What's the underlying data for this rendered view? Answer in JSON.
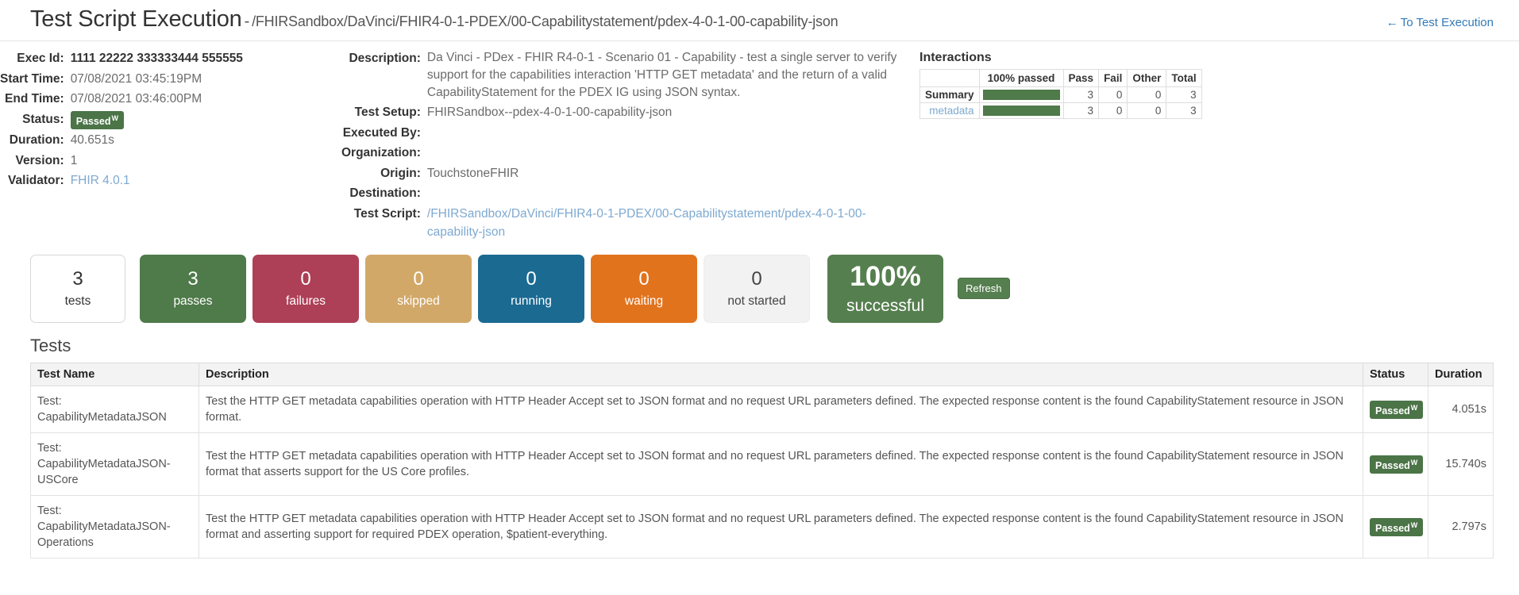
{
  "header": {
    "title": "Test Script Execution",
    "separator": "-",
    "subtitle": "/FHIRSandbox/DaVinci/FHIR4-0-1-PDEX/00-Capabilitystatement/pdex-4-0-1-00-capability-json",
    "back_link": "To Test Execution",
    "back_arrow": "←",
    "link_color": "#337ab7"
  },
  "details_left": [
    {
      "label": "Exec Id:",
      "value": "1111 22222 333333444 555555",
      "style": "dark"
    },
    {
      "label": "Start Time:",
      "value": "07/08/2021 03:45:19PM",
      "style": "plain"
    },
    {
      "label": "End Time:",
      "value": "07/08/2021 03:46:00PM",
      "style": "plain"
    },
    {
      "label": "Status:",
      "value": "Passed",
      "style": "chip",
      "chip_sup": "W"
    },
    {
      "label": "Duration:",
      "value": "40.651s",
      "style": "plain"
    },
    {
      "label": "Version:",
      "value": "1",
      "style": "plain"
    },
    {
      "label": "Validator:",
      "value": "FHIR 4.0.1",
      "style": "link"
    }
  ],
  "details_mid": [
    {
      "label": "Description:",
      "value": "Da Vinci - PDex - FHIR R4-0-1 - Scenario 01 - Capability - test a single server to verify support for the capabilities interaction 'HTTP GET metadata' and the return of a valid CapabilityStatement for the PDEX IG using JSON syntax.",
      "style": "plain"
    },
    {
      "label": "Test Setup:",
      "value": "FHIRSandbox--pdex-4-0-1-00-capability-json",
      "style": "plain"
    },
    {
      "label": "Executed By:",
      "value": "",
      "style": "plain"
    },
    {
      "label": "Organization:",
      "value": "",
      "style": "plain"
    },
    {
      "label": "Origin:",
      "value": "TouchstoneFHIR",
      "style": "plain"
    },
    {
      "label": "Destination:",
      "value": "",
      "style": "plain"
    },
    {
      "label": "Test Script:",
      "value": "/FHIRSandbox/DaVinci/FHIR4-0-1-PDEX/00-Capabilitystatement/pdex-4-0-1-00-capability-json",
      "style": "link"
    }
  ],
  "interactions": {
    "title": "Interactions",
    "columns": [
      "",
      "100% passed",
      "Pass",
      "Fail",
      "Other",
      "Total"
    ],
    "rows": [
      {
        "name": "Summary",
        "is_link": false,
        "percent": 100,
        "pass": "3",
        "fail": "0",
        "other": "0",
        "total": "3"
      },
      {
        "name": "metadata",
        "is_link": true,
        "percent": 100,
        "pass": "3",
        "fail": "0",
        "other": "0",
        "total": "3"
      }
    ],
    "bar_color": "#4f7a4a"
  },
  "stats": [
    {
      "key": "tests",
      "number": "3",
      "label": "tests",
      "color": "#ffffff"
    },
    {
      "key": "passes",
      "number": "3",
      "label": "passes",
      "color": "#4f7a4a"
    },
    {
      "key": "failures",
      "number": "0",
      "label": "failures",
      "color": "#ad3f56"
    },
    {
      "key": "skipped",
      "number": "0",
      "label": "skipped",
      "color": "#d2a868"
    },
    {
      "key": "running",
      "number": "0",
      "label": "running",
      "color": "#1a6a92"
    },
    {
      "key": "waiting",
      "number": "0",
      "label": "waiting",
      "color": "#e2731d"
    },
    {
      "key": "notstarted",
      "number": "0",
      "label": "not started",
      "color": "#f2f2f2"
    },
    {
      "key": "successful",
      "number": "100%",
      "label": "successful",
      "color": "#567f4f"
    }
  ],
  "refresh_label": "Refresh",
  "tests_section": {
    "heading": "Tests",
    "columns": [
      "Test Name",
      "Description",
      "Status",
      "Duration"
    ],
    "rows": [
      {
        "name_prefix": "Test:",
        "name": "CapabilityMetadataJSON",
        "description": "Test the HTTP GET metadata capabilities operation with HTTP Header Accept set to JSON format and no request URL parameters defined. The expected response content is the found CapabilityStatement resource in JSON format.",
        "status": "Passed",
        "status_sup": "W",
        "duration": "4.051s"
      },
      {
        "name_prefix": "Test:",
        "name": "CapabilityMetadataJSON-USCore",
        "description": "Test the HTTP GET metadata capabilities operation with HTTP Header Accept set to JSON format and no request URL parameters defined. The expected response content is the found CapabilityStatement resource in JSON format that asserts support for the US Core profiles.",
        "status": "Passed",
        "status_sup": "W",
        "duration": "15.740s"
      },
      {
        "name_prefix": "Test:",
        "name": "CapabilityMetadataJSON-Operations",
        "description": "Test the HTTP GET metadata capabilities operation with HTTP Header Accept set to JSON format and no request URL parameters defined. The expected response content is the found CapabilityStatement resource in JSON format and asserting support for required PDEX operation, $patient-everything.",
        "status": "Passed",
        "status_sup": "W",
        "duration": "2.797s"
      }
    ]
  }
}
